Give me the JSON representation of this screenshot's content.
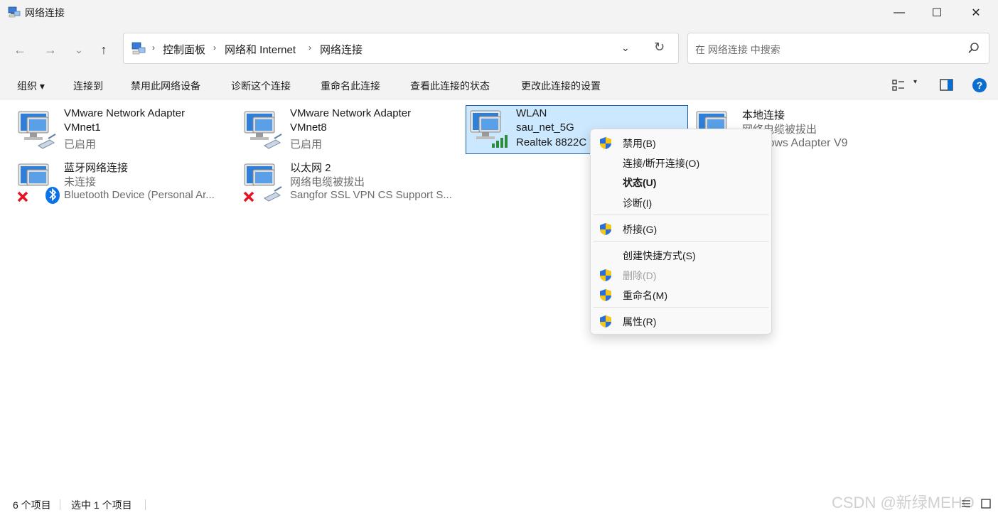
{
  "window": {
    "title": "网络连接",
    "minimize_glyph": "—",
    "maximize_glyph": "☐",
    "close_glyph": "✕"
  },
  "nav": {
    "back_glyph": "←",
    "forward_glyph": "→",
    "recent_glyph": "⌄",
    "up_glyph": "↑"
  },
  "address": {
    "crumbs": [
      "控制面板",
      "网络和 Internet",
      "网络连接"
    ],
    "separator": "›",
    "dropdown_glyph": "⌄",
    "refresh_glyph": "↻"
  },
  "search": {
    "placeholder": "在 网络连接 中搜索"
  },
  "commands": {
    "organize": "组织 ▾",
    "connect_to": "连接到",
    "disable_device": "禁用此网络设备",
    "diagnose": "诊断这个连接",
    "rename": "重命名此连接",
    "view_status": "查看此连接的状态",
    "change_settings": "更改此连接的设置",
    "view_dropdown_glyph": "▾",
    "help_glyph": "?"
  },
  "items": [
    {
      "name": "VMware Network Adapter",
      "line2": "VMnet1",
      "line3": "已启用",
      "icon": "network-cable-icon",
      "status": "enabled"
    },
    {
      "name": "VMware Network Adapter",
      "line2": "VMnet8",
      "line3": "已启用",
      "icon": "network-cable-icon",
      "status": "enabled"
    },
    {
      "name": "WLAN",
      "line2": "sau_net_5G",
      "line3": "Realtek 8822C",
      "icon": "wifi-signal-icon",
      "status": "selected"
    },
    {
      "name": "本地连接",
      "line2": "网络电缆被拔出",
      "line3": "Windows Adapter V9",
      "icon": "network-cable-icon",
      "status": "unplugged"
    },
    {
      "name": "蓝牙网络连接",
      "line2": "未连接",
      "line3": "Bluetooth Device (Personal Ar...",
      "icon": "bluetooth-icon",
      "status": "disconnected"
    },
    {
      "name": "以太网 2",
      "line2": "网络电缆被拔出",
      "line3": "Sangfor SSL VPN CS Support S...",
      "icon": "network-cable-icon",
      "status": "disconnected"
    }
  ],
  "context_menu": {
    "items": [
      {
        "label": "禁用(B)",
        "shield": true,
        "bold": false,
        "disabled": false
      },
      {
        "label": "连接/断开连接(O)",
        "shield": false,
        "bold": false,
        "disabled": false
      },
      {
        "label": "状态(U)",
        "shield": false,
        "bold": true,
        "disabled": false
      },
      {
        "label": "诊断(I)",
        "shield": false,
        "bold": false,
        "disabled": false
      },
      {
        "label": "桥接(G)",
        "shield": true,
        "bold": false,
        "disabled": false
      },
      {
        "label": "创建快捷方式(S)",
        "shield": false,
        "bold": false,
        "disabled": false
      },
      {
        "label": "删除(D)",
        "shield": true,
        "bold": false,
        "disabled": true
      },
      {
        "label": "重命名(M)",
        "shield": true,
        "bold": false,
        "disabled": false
      },
      {
        "label": "属性(R)",
        "shield": true,
        "bold": false,
        "disabled": false
      }
    ]
  },
  "status": {
    "item_count": "6 个项目",
    "selected_count": "选中 1 个项目"
  },
  "watermark": "CSDN @新绿MEHO",
  "colors": {
    "accent": "#0a6ed1",
    "selection_bg": "#cce8ff",
    "selection_border": "#1e5fa8",
    "error_red": "#e81123",
    "bluetooth_blue": "#0a73e8",
    "signal_green": "#2e8b3e",
    "shield_blue": "#2a6fd6",
    "shield_yellow": "#f5c518"
  }
}
